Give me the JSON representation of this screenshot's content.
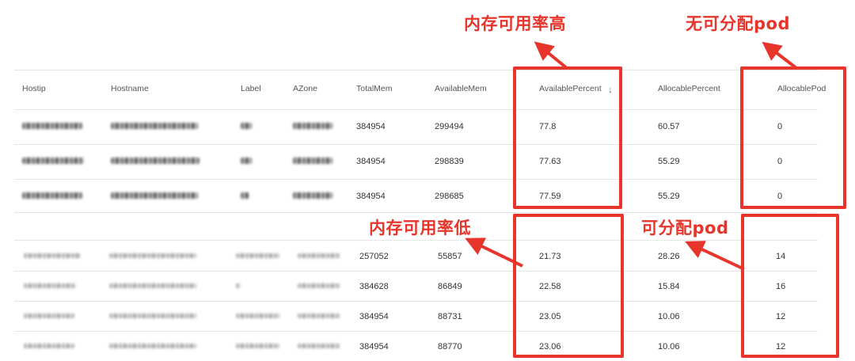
{
  "columns": {
    "hostip": "Hostip",
    "hostname": "Hostname",
    "label": "Label",
    "azone": "AZone",
    "totalmem": "TotalMem",
    "availablemem": "AvailableMem",
    "availablepercent": "AvailablePercent",
    "allocablepercent": "AllocablePercent",
    "allocablepod": "AllocablePod"
  },
  "sort_icon": "arrow-down-icon",
  "top_rows": [
    {
      "totalmem": "384954",
      "availablemem": "299494",
      "availablepercent": "77.8",
      "allocablepercent": "60.57",
      "allocablepod": "0"
    },
    {
      "totalmem": "384954",
      "availablemem": "298839",
      "availablepercent": "77.63",
      "allocablepercent": "55.29",
      "allocablepod": "0"
    },
    {
      "totalmem": "384954",
      "availablemem": "298685",
      "availablepercent": "77.59",
      "allocablepercent": "55.29",
      "allocablepod": "0"
    }
  ],
  "bottom_rows": [
    {
      "totalmem": "257052",
      "availablemem": "55857",
      "availablepercent": "21.73",
      "allocablepercent": "28.26",
      "allocablepod": "14"
    },
    {
      "totalmem": "384628",
      "availablemem": "86849",
      "availablepercent": "22.58",
      "allocablepercent": "15.84",
      "allocablepod": "16"
    },
    {
      "totalmem": "384954",
      "availablemem": "88731",
      "availablepercent": "23.05",
      "allocablepercent": "10.06",
      "allocablepod": "12"
    },
    {
      "totalmem": "384954",
      "availablemem": "88770",
      "availablepercent": "23.06",
      "allocablepercent": "10.06",
      "allocablepod": "12"
    }
  ],
  "annotations": {
    "high_mem": "内存可用率高",
    "no_pod": "无可分配pod",
    "low_mem": "内存可用率低",
    "has_pod": "可分配pod"
  },
  "colors": {
    "annotation_red": "#e8352b"
  }
}
